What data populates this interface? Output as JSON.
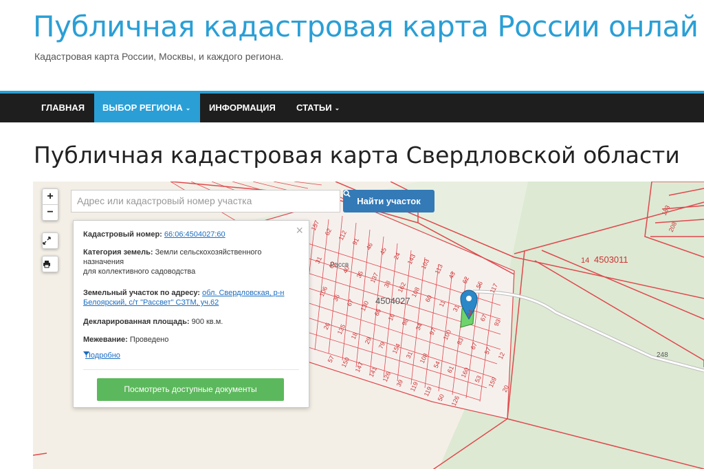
{
  "header": {
    "site_title": "Публичная кадастровая карта России онлай",
    "site_description": "Кадастровая карта России, Москвы, и каждого региона."
  },
  "nav": {
    "items": [
      {
        "label": "ГЛАВНАЯ"
      },
      {
        "label": "ВЫБОР РЕГИОНА",
        "caret": "⌄"
      },
      {
        "label": "ИНФОРМАЦИЯ"
      },
      {
        "label": "СТАТЬИ",
        "caret": "⌄"
      }
    ]
  },
  "page": {
    "title": "Публичная кадастровая карта Свердловской области"
  },
  "map": {
    "controls": {
      "zoom_in": "+",
      "zoom_out": "−",
      "fullscreen_icon": "fullscreen-icon",
      "print_icon": "print-icon"
    },
    "search": {
      "placeholder": "Адрес или кадастровый номер участка",
      "button_label": "Найти участок",
      "button_icon": "search-icon"
    },
    "labels": {
      "quarter_main": "4504027",
      "quarter_east": "4503011",
      "quarter_east_prefix": "14",
      "road_number": "248",
      "settlement": "Рассв"
    },
    "parcel_numbers": [
      "157",
      "62",
      "112",
      "91",
      "46",
      "45",
      "24",
      "143",
      "103",
      "113",
      "43",
      "62",
      "56",
      "117",
      "31",
      "62",
      "40",
      "35",
      "137",
      "38",
      "162",
      "108",
      "60",
      "11",
      "31",
      "44",
      "67",
      "93",
      "106",
      "36",
      "67",
      "130",
      "66",
      "16",
      "98",
      "34",
      "97",
      "100",
      "83",
      "67",
      "57",
      "12",
      "26",
      "135",
      "18",
      "29",
      "79",
      "154",
      "31",
      "108",
      "54",
      "61",
      "160",
      "53",
      "159",
      "20",
      "57",
      "150",
      "147",
      "141",
      "126",
      "39",
      "119",
      "119",
      "50",
      "126",
      "183",
      "208"
    ],
    "popup": {
      "close": "×",
      "cadastral_label": "Кадастровый номер:",
      "cadastral_value": "66:06:4504027:60",
      "category_label": "Категория земель:",
      "category_value_1": "Земли сельскохозяйственного",
      "category_value_2": "назначения",
      "category_value_3": "для коллективного садоводства",
      "address_label": "Земельный участок по адресу:",
      "address_value_1": "обл. Свердловская, р-н",
      "address_value_2": "Белоярский, с/т \"Рассвет\" СЗТМ, уч.62",
      "area_label": "Декларированная площадь:",
      "area_value": "900 кв.м.",
      "survey_label": "Межевание:",
      "survey_value": "Проведено",
      "more_label": "Подробно",
      "docs_button": "Посмотреть доступные документы"
    }
  },
  "colors": {
    "accent": "#2a9fd6",
    "nav_bg": "#1e1e1e",
    "search_button": "#337ab7",
    "docs_button": "#5cb85c",
    "parcel_line": "#e0474c",
    "green_area": "#dde9d3"
  }
}
